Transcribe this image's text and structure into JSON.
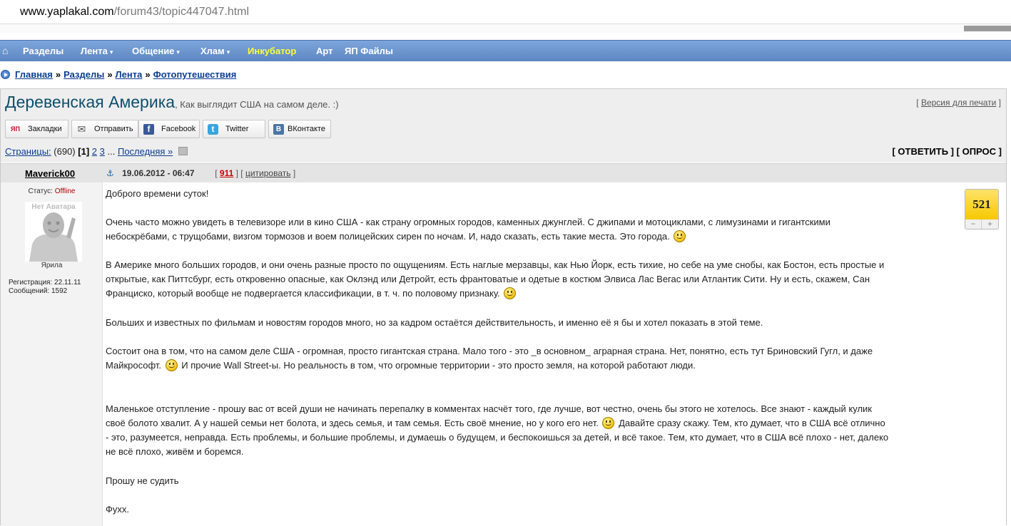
{
  "browser": {
    "url_host": "www.yaplakal.com",
    "url_path": "/forum43/topic447047.html"
  },
  "nav": {
    "home_icon": "⌂",
    "items": [
      {
        "label": "Разделы",
        "dropdown": false,
        "highlight": false
      },
      {
        "label": "Лента",
        "dropdown": true,
        "highlight": false
      },
      {
        "label": "Общение",
        "dropdown": true,
        "highlight": false
      },
      {
        "label": "Хлам",
        "dropdown": true,
        "highlight": false
      },
      {
        "label": "Инкубатор",
        "dropdown": false,
        "highlight": true
      },
      {
        "label": "Арт",
        "dropdown": false,
        "highlight": false
      },
      {
        "label": "ЯП Файлы",
        "dropdown": false,
        "highlight": false
      }
    ],
    "dropdown_caret": "▾",
    "highlight_color": "#ffff33"
  },
  "breadcrumb": {
    "items": [
      "Главная",
      "Разделы",
      "Лента",
      "Фотопутешествия"
    ],
    "separator": "»"
  },
  "topic": {
    "title": "Деревенская Америка",
    "subtitle": ", Как выглядит США на самом деле. :)",
    "print_prefix": "[",
    "print_link": "Версия для печати",
    "print_suffix": "]"
  },
  "share": {
    "buttons": [
      {
        "label": "Закладки",
        "icon": "ЯП",
        "icon_color": "#c8102e"
      },
      {
        "label": "Отправить",
        "icon": "✉",
        "icon_color": "#666666"
      },
      {
        "label": "Facebook",
        "icon": "f",
        "icon_color": "#3b5998"
      },
      {
        "label": "Twitter",
        "icon": "t",
        "icon_color": "#3aa4dd"
      },
      {
        "label": "ВКонтакте",
        "icon": "В",
        "icon_color": "#4c75a3"
      }
    ]
  },
  "pages": {
    "label": "Страницы:",
    "count": "(690)",
    "current": "[1]",
    "next": [
      "2",
      "3"
    ],
    "ellipsis": "...",
    "last": "Последняя »",
    "reply": "[ ОТВЕТИТЬ ]",
    "poll": "[ ОПРОС ]"
  },
  "post": {
    "author": "Maverick00",
    "anchor_icon": "⚓",
    "date": "19.06.2012 - 06:47",
    "num_open": "[",
    "num": "911",
    "num_close": "]",
    "quote_open": "[",
    "quote": "цитировать",
    "quote_close": "]",
    "status_label": "Статус:",
    "status_value": "Offline",
    "avatar_label": "Нет Аватара",
    "rank": "Ярила",
    "registration": "Регистрация: 22.11.11",
    "messages": "Сообщений: 1592",
    "rating": "521",
    "rating_minus": "−",
    "rating_plus": "+",
    "body": {
      "p1": "Доброго времени суток!",
      "p2a": "Очень часто можно увидеть в телевизоре или в кино США - как страну огромных городов, каменных джунглей. С джипами и мотоциклами, с лимузинами и гигантскими",
      "p2b": "небоскрёбами, с трущобами, визгом тормозов и воем полицейских сирен по ночам. И, надо сказать, есть такие места. Это города.",
      "p3a": "В Америке много больших городов, и они очень разные просто по ощущениям. Есть наглые мерзавцы, как Нью Йорк, есть тихие, но себе на уме снобы, как Бостон, есть простые и",
      "p3b": "открытые, как Питтсбург, есть откровенно опасные, как Оклэнд или Детройт, есть франтоватые и одетые в костюм Элвиса Лас Вегас или Атлантик Сити. Ну и есть, скажем, Сан",
      "p3c": "Франциско, который вообще не подвергается классификации, в т. ч. по половому признаку.",
      "p4": "Больших и известных по фильмам и новостям городов много, но за кадром остаётся действительность, и именно её я бы и хотел показать в этой теме.",
      "p5a": "Состоит она в том, что на самом деле США - огромная, просто гигантская страна. Мало того - это _в основном_ аграрная страна. Нет, понятно, есть тут Бриновский Гугл, и даже",
      "p5b1": "Майкрософт.",
      "p5b2": "И прочие Wall Street-ы. Но реальность в том, что огромные территории - это просто земля, на которой работают люди.",
      "p6a": "Маленькое отступление - прошу вас от всей души не начинать перепалку в комментах насчёт того, где лучше, вот честно, очень бы этого не хотелось. Все знают - каждый кулик",
      "p6b1": "своё болото хвалит. А у нашей семьи нет болота, и здесь семья, и там семья. Есть своё мнение, но у кого его нет.",
      "p6b2": "Давайте сразу скажу. Тем, кто думает, что в США всё отлично",
      "p6c": "- это, разумеется, неправда. Есть проблемы, и большие проблемы, и думаешь о будущем, и беспокоишься за детей, и всё такое. Тем, кто думает, что в США всё плохо - нет, далеко",
      "p6d": "не всё плохо, живём и боремся.",
      "p7": "Прошу не судить",
      "p8": "Фухх."
    }
  }
}
